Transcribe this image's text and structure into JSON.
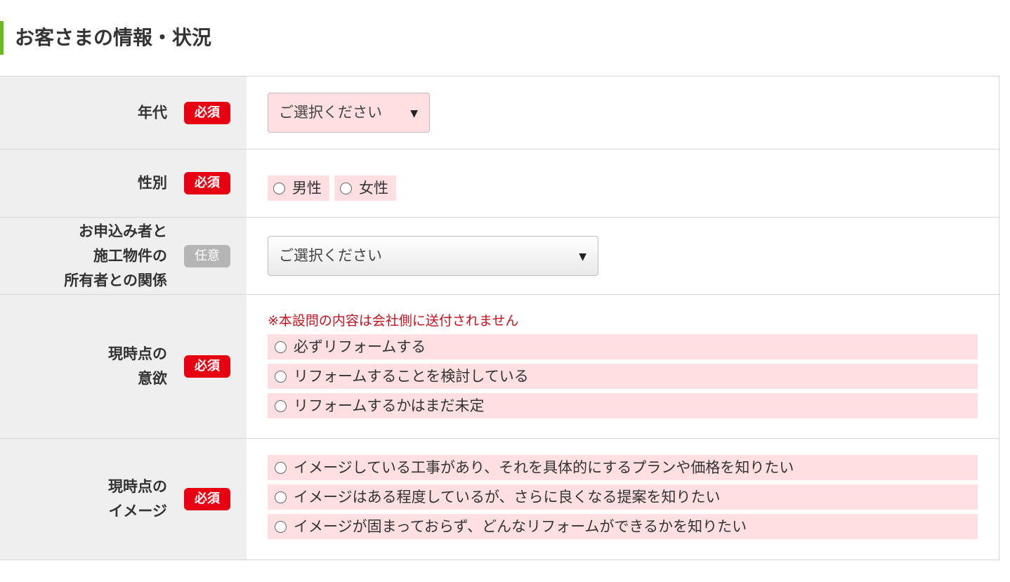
{
  "section": {
    "title": "お客さまの情報・状況"
  },
  "badges": {
    "required": "必須",
    "optional": "任意"
  },
  "rows": {
    "age": {
      "label": [
        "年代"
      ],
      "badge": "必須",
      "select_value": "ご選択ください",
      "arrow": "▼"
    },
    "gender": {
      "label": [
        "性別"
      ],
      "badge": "必須",
      "options": [
        "男性",
        "女性"
      ]
    },
    "relationship": {
      "label": [
        "お申込み者と",
        "施工物件の",
        "所有者との関係"
      ],
      "badge": "任意",
      "select_value": "ご選択ください",
      "arrow": "▼"
    },
    "motivation": {
      "label": [
        "現時点の",
        "意欲"
      ],
      "badge": "必須",
      "note": "※本設問の内容は会社側に送付されません",
      "options": [
        "必ずリフォームする",
        "リフォームすることを検討している",
        "リフォームするかはまだ未定"
      ]
    },
    "image": {
      "label": [
        "現時点の",
        "イメージ"
      ],
      "badge": "必須",
      "options": [
        "イメージしている工事があり、それを具体的にするプランや価格を知りたい",
        "イメージはある程度しているが、さらに良くなる提案を知りたい",
        "イメージが固まっておらず、どんなリフォームができるかを知りたい"
      ]
    }
  },
  "colors": {
    "accent_bar": "#6cbb1e",
    "required_badge": "#e60012",
    "optional_badge": "#b5b5b5",
    "field_highlight": "#ffdfe2",
    "label_bg": "#efefef",
    "note_text": "#c0121e"
  }
}
